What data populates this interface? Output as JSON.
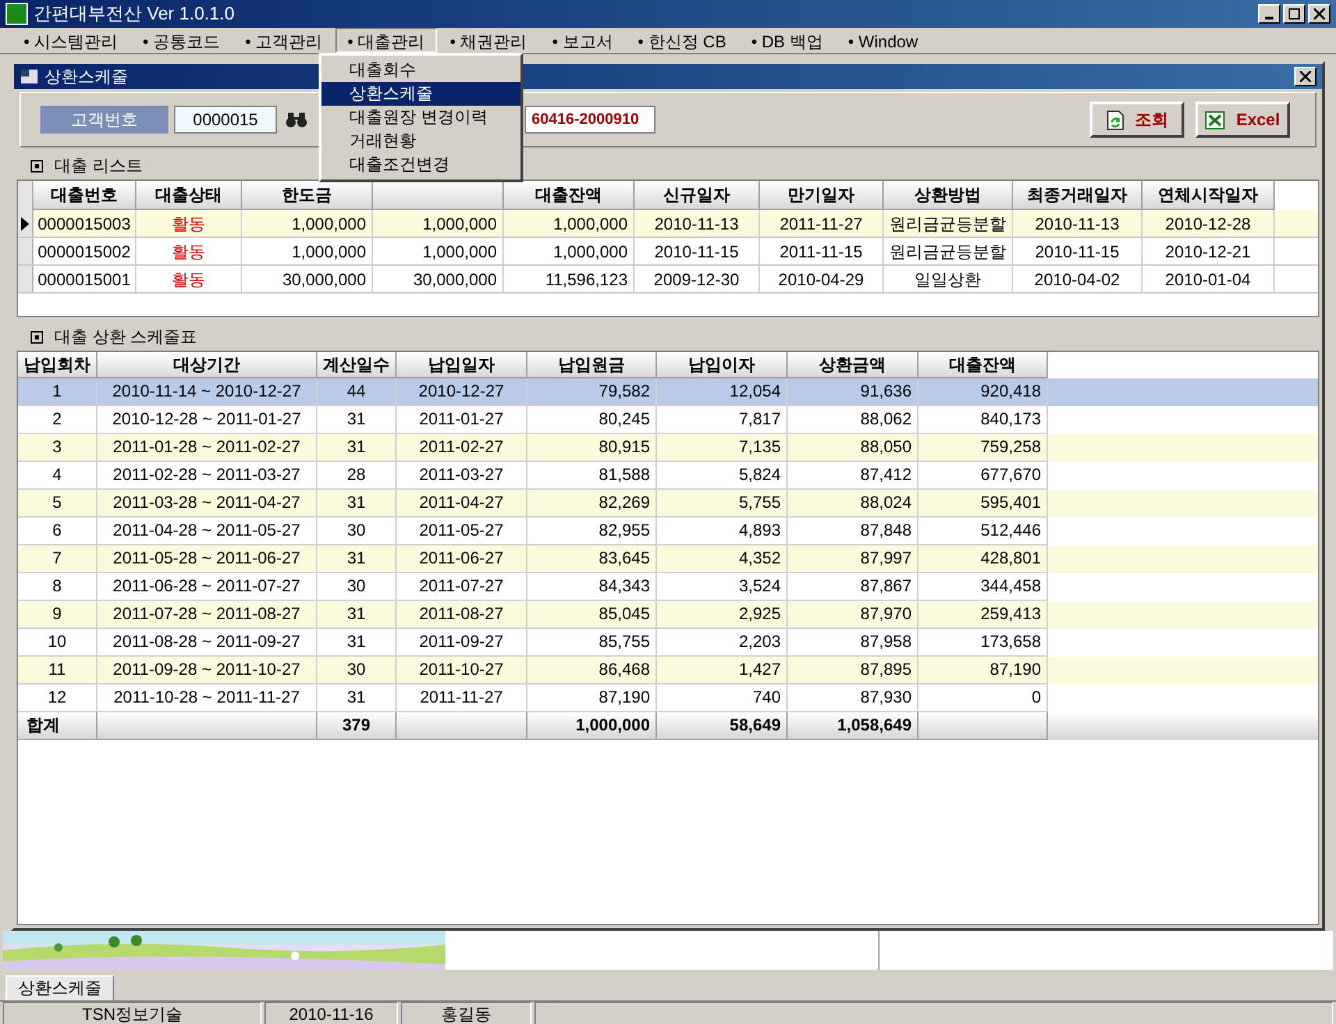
{
  "window": {
    "title": "간편대부전산 Ver 1.0.1.0"
  },
  "menu": [
    {
      "label": "• 시스템관리",
      "selected": false
    },
    {
      "label": "• 공통코드",
      "selected": false
    },
    {
      "label": "• 고객관리",
      "selected": false
    },
    {
      "label": "• 대출관리",
      "selected": true
    },
    {
      "label": "• 채권관리",
      "selected": false
    },
    {
      "label": "• 보고서",
      "selected": false
    },
    {
      "label": "• 한신정 CB",
      "selected": false
    },
    {
      "label": "• DB 백업",
      "selected": false
    },
    {
      "label": "• Window",
      "selected": false
    }
  ],
  "dropdown": [
    {
      "label": "대출회수",
      "selected": false
    },
    {
      "label": "상환스케줄",
      "selected": true
    },
    {
      "label": "대출원장 변경이력",
      "selected": false
    },
    {
      "label": "거래현황",
      "selected": false
    },
    {
      "label": "대출조건변경",
      "selected": false
    }
  ],
  "child": {
    "title": "상환스케줄",
    "customer": {
      "label": "고객번호",
      "value": "0000015",
      "id": "60416-2000910"
    },
    "buttons": [
      {
        "label": "조회",
        "kind": "refresh"
      },
      {
        "label": "Excel",
        "kind": "excel"
      }
    ],
    "loans": {
      "title": "대출 리스트",
      "columns": [
        "대출번호",
        "대출상태",
        "한도금",
        "",
        "대출잔액",
        "신규일자",
        "만기일자",
        "상환방법",
        "최종거래일자",
        "연체시작일자"
      ],
      "rows": [
        {
          "selected": true,
          "cells": [
            "0000015003",
            "활동",
            "1,000,000",
            "1,000,000",
            "1,000,000",
            "2010-11-13",
            "2011-11-27",
            "원리금균등분할",
            "2010-11-13",
            "2010-12-28"
          ]
        },
        {
          "selected": false,
          "cells": [
            "0000015002",
            "활동",
            "1,000,000",
            "1,000,000",
            "1,000,000",
            "2010-11-15",
            "2011-11-15",
            "원리금균등분할",
            "2010-11-15",
            "2010-12-21"
          ]
        },
        {
          "selected": false,
          "cells": [
            "0000015001",
            "활동",
            "30,000,000",
            "30,000,000",
            "11,596,123",
            "2009-12-30",
            "2010-04-29",
            "일일상환",
            "2010-04-02",
            "2010-01-04"
          ]
        }
      ]
    },
    "schedule": {
      "title": "대출 상환 스케줄표",
      "columns": [
        "납입회차",
        "대상기간",
        "계산일수",
        "납입일자",
        "납입원금",
        "납입이자",
        "상환금액",
        "대출잔액"
      ],
      "rows": [
        {
          "selected": true,
          "cells": [
            "1",
            "2010-11-14 ~ 2010-12-27",
            "44",
            "2010-12-27",
            "79,582",
            "12,054",
            "91,636",
            "920,418"
          ]
        },
        {
          "selected": false,
          "cells": [
            "2",
            "2010-12-28 ~ 2011-01-27",
            "31",
            "2011-01-27",
            "80,245",
            "7,817",
            "88,062",
            "840,173"
          ]
        },
        {
          "selected": false,
          "cells": [
            "3",
            "2011-01-28 ~ 2011-02-27",
            "31",
            "2011-02-27",
            "80,915",
            "7,135",
            "88,050",
            "759,258"
          ]
        },
        {
          "selected": false,
          "cells": [
            "4",
            "2011-02-28 ~ 2011-03-27",
            "28",
            "2011-03-27",
            "81,588",
            "5,824",
            "87,412",
            "677,670"
          ]
        },
        {
          "selected": false,
          "cells": [
            "5",
            "2011-03-28 ~ 2011-04-27",
            "31",
            "2011-04-27",
            "82,269",
            "5,755",
            "88,024",
            "595,401"
          ]
        },
        {
          "selected": false,
          "cells": [
            "6",
            "2011-04-28 ~ 2011-05-27",
            "30",
            "2011-05-27",
            "82,955",
            "4,893",
            "87,848",
            "512,446"
          ]
        },
        {
          "selected": false,
          "cells": [
            "7",
            "2011-05-28 ~ 2011-06-27",
            "31",
            "2011-06-27",
            "83,645",
            "4,352",
            "87,997",
            "428,801"
          ]
        },
        {
          "selected": false,
          "cells": [
            "8",
            "2011-06-28 ~ 2011-07-27",
            "30",
            "2011-07-27",
            "84,343",
            "3,524",
            "87,867",
            "344,458"
          ]
        },
        {
          "selected": false,
          "cells": [
            "9",
            "2011-07-28 ~ 2011-08-27",
            "31",
            "2011-08-27",
            "85,045",
            "2,925",
            "87,970",
            "259,413"
          ]
        },
        {
          "selected": false,
          "cells": [
            "10",
            "2011-08-28 ~ 2011-09-27",
            "31",
            "2011-09-27",
            "85,755",
            "2,203",
            "87,958",
            "173,658"
          ]
        },
        {
          "selected": false,
          "cells": [
            "11",
            "2011-09-28 ~ 2011-10-27",
            "30",
            "2011-10-27",
            "86,468",
            "1,427",
            "87,895",
            "87,190"
          ]
        },
        {
          "selected": false,
          "cells": [
            "12",
            "2011-10-28 ~ 2011-11-27",
            "31",
            "2011-11-27",
            "87,190",
            "740",
            "87,930",
            "0"
          ]
        }
      ],
      "total": {
        "label": "합계",
        "days": "379",
        "principal": "1,000,000",
        "interest": "58,649",
        "amount": "1,058,649"
      }
    }
  },
  "tabs": [
    {
      "label": "상환스케줄",
      "selected": true
    }
  ],
  "status_bar": [
    "TSN정보기술",
    "2010-11-16",
    "홍길동"
  ]
}
